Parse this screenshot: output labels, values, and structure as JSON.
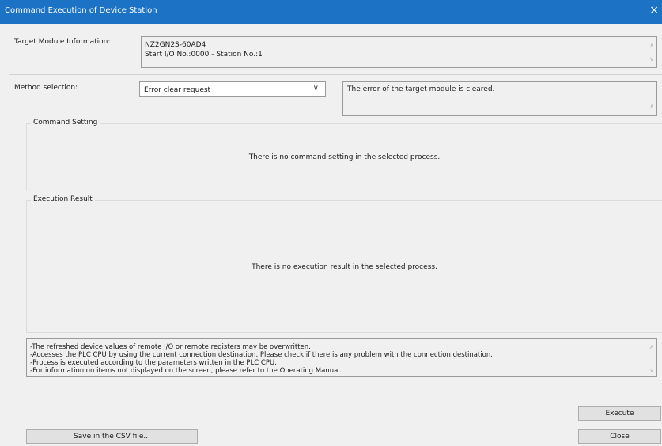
{
  "window": {
    "title": "Command Execution of Device Station",
    "close_glyph": "×"
  },
  "target_module": {
    "label": "Target Module Information:",
    "line1": "NZ2GN2S-60AD4",
    "line2": "Start I/O No.:0000 - Station No.:1"
  },
  "method": {
    "label": "Method selection:",
    "selected": "Error clear request",
    "description": "The error of the target module is cleared."
  },
  "command_setting": {
    "legend": "Command Setting",
    "message": "There is no command setting in the selected process."
  },
  "execution_result": {
    "legend": "Execution Result",
    "message": "There is no execution result in the selected process."
  },
  "notes": [
    "-The refreshed device values of remote I/O or remote registers may be overwritten.",
    "-Accesses the PLC CPU by using the current connection destination. Please check if there is any problem with the connection destination.",
    "-Process is executed according to the parameters written in the PLC CPU.",
    "-For information on items not displayed on the screen, please refer to the Operating Manual."
  ],
  "buttons": {
    "execute": "Execute",
    "save_csv": "Save in the CSV file...",
    "close": "Close"
  },
  "icons": {
    "scroll_up": "∧",
    "scroll_down": "∨",
    "dropdown": "∨"
  },
  "colors": {
    "titlebar": "#1c72c4",
    "background": "#f0f0f0"
  }
}
